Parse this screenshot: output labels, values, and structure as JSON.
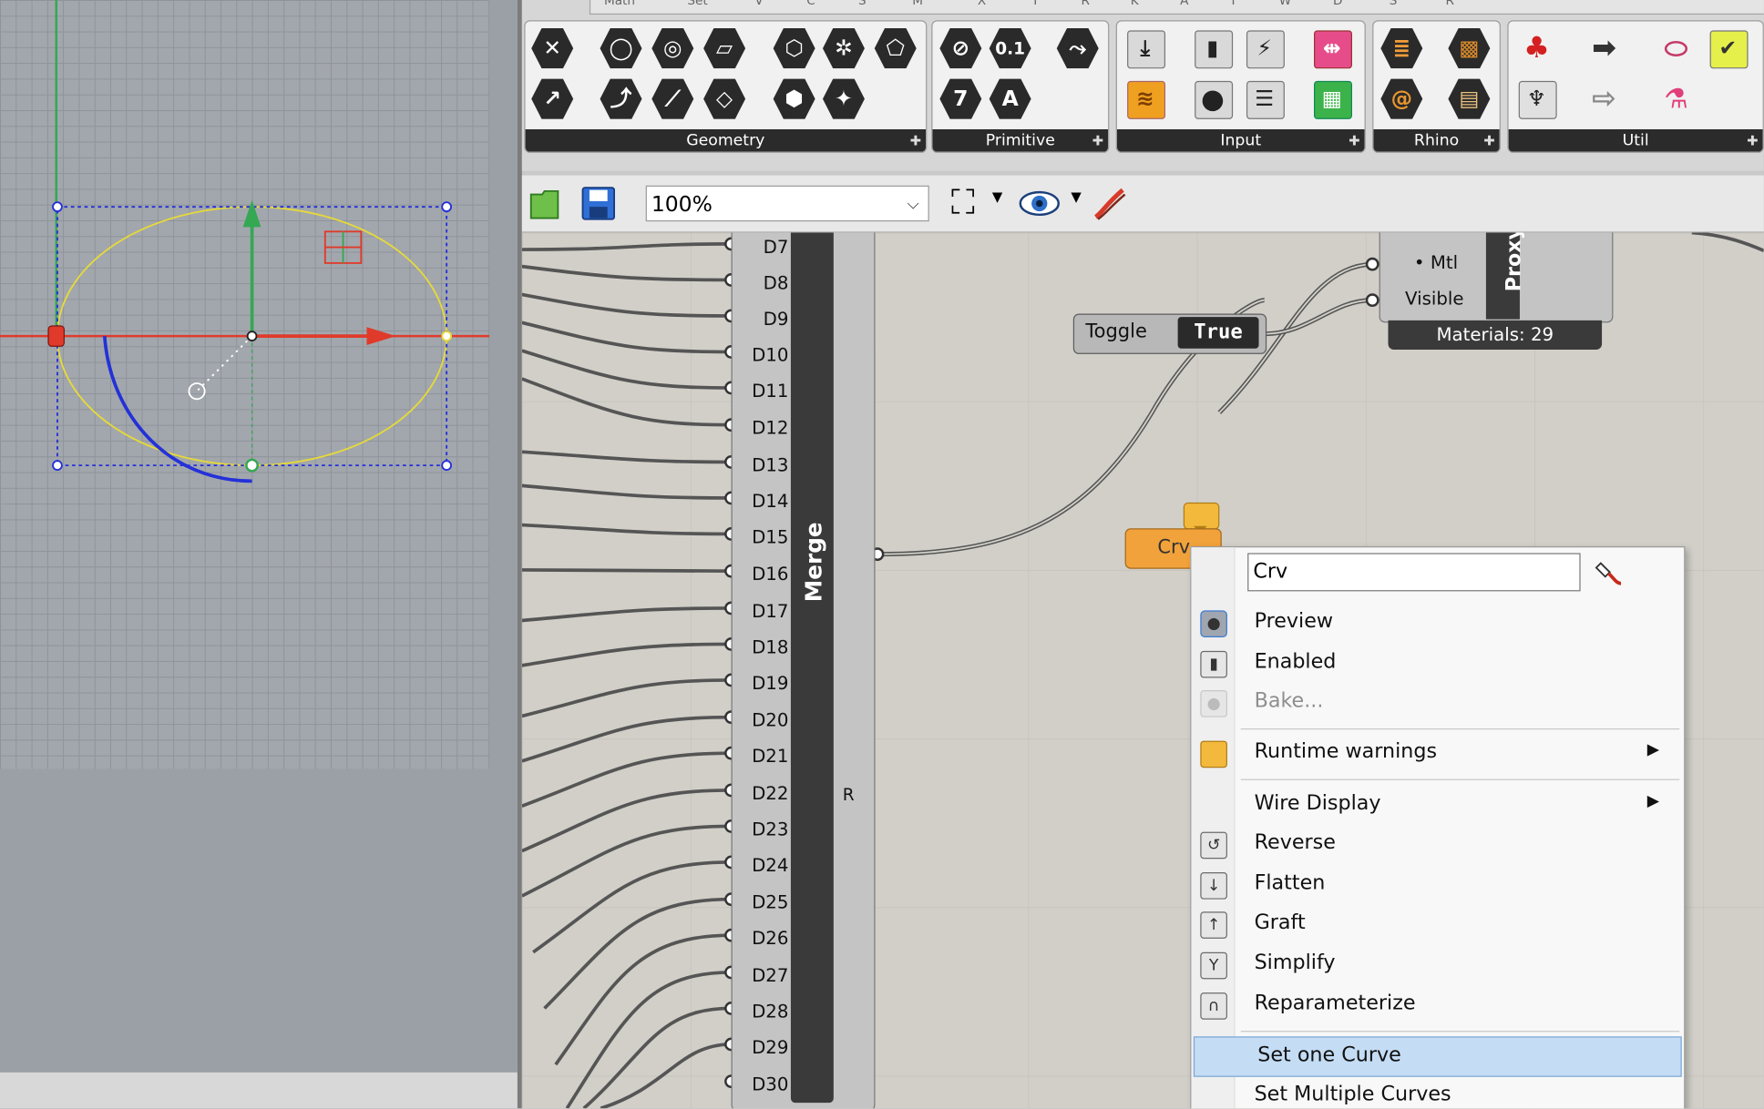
{
  "viewport": {
    "colors": {
      "grid": "#a2a7ad",
      "x_axis": "#e03a2a",
      "y_axis": "#34a853",
      "curve": "#2431d8",
      "ellipse": "#e6d93a"
    }
  },
  "ribbon": {
    "tabs": [
      "Math",
      "Set",
      "V",
      "C",
      "S",
      "M",
      "X",
      "T",
      "R",
      "K",
      "A",
      "T",
      "W",
      "D",
      "S",
      "R"
    ],
    "groups": [
      {
        "name": "Geometry",
        "tools": [
          "close-icon",
          "circle-icon",
          "circular-icon",
          "curve-icon",
          "box-icon",
          "mesh-icon",
          "surface-icon",
          "vector-icon",
          "arc-icon",
          "line-icon",
          "transform-icon",
          "point-icon",
          "field-icon"
        ]
      },
      {
        "name": "Primitive",
        "tools": [
          "number-icon",
          "decimal-icon",
          "integer-icon",
          "text-icon",
          "path-icon"
        ]
      },
      {
        "name": "Input",
        "tools": [
          "import-icon",
          "boolean-icon",
          "slider-icon",
          "graph-icon",
          "signal-icon",
          "button-icon",
          "list-icon",
          "swatch-icon"
        ]
      },
      {
        "name": "Rhino",
        "tools": [
          "layer-icon",
          "texture-icon",
          "spiral-icon",
          "grid-icon"
        ]
      },
      {
        "name": "Util",
        "tools": [
          "cherry-icon",
          "arrow-right-icon",
          "flask-icon",
          "tree-icon",
          "arrow-outline-icon",
          "potion-icon",
          "pipette-icon",
          "check-icon"
        ]
      }
    ],
    "glyphs": {
      "decimal": "0.1",
      "integer": "7",
      "text": "A"
    }
  },
  "toolbar": {
    "zoom": "100%"
  },
  "canvas": {
    "merge": {
      "title": "Merge",
      "output": "R",
      "ports": [
        "D7",
        "D8",
        "D9",
        "D10",
        "D11",
        "D12",
        "D13",
        "D14",
        "D15",
        "D16",
        "D17",
        "D18",
        "D19",
        "D20",
        "D21",
        "D22",
        "D23",
        "D24",
        "D25",
        "D26",
        "D27",
        "D28",
        "D29",
        "D30"
      ]
    },
    "toggle": {
      "label": "Toggle",
      "value": "True"
    },
    "proxy": {
      "title": "Proxy",
      "input_mtl": "• Mtl",
      "input_visible": "Visible",
      "materials": "Materials: 29"
    },
    "crv": {
      "label": "Crv"
    }
  },
  "context_menu": {
    "name_value": "Crv",
    "items": [
      {
        "label": "Preview",
        "icon": "preview-icon",
        "state": "checked"
      },
      {
        "label": "Enabled",
        "icon": "enabled-icon",
        "state": "normal"
      },
      {
        "label": "Bake...",
        "icon": "bake-icon",
        "state": "disabled"
      },
      {
        "label": "Runtime warnings",
        "icon": "warning-icon",
        "submenu": true
      },
      {
        "label": "Wire Display",
        "submenu": true
      },
      {
        "label": "Reverse",
        "icon": "reverse-icon"
      },
      {
        "label": "Flatten",
        "icon": "flatten-icon"
      },
      {
        "label": "Graft",
        "icon": "graft-icon"
      },
      {
        "label": "Simplify",
        "icon": "simplify-icon"
      },
      {
        "label": "Reparameterize",
        "icon": "reparameterize-icon"
      },
      {
        "label": "Set one Curve",
        "state": "highlighted"
      },
      {
        "label": "Set Multiple Curves"
      }
    ]
  }
}
